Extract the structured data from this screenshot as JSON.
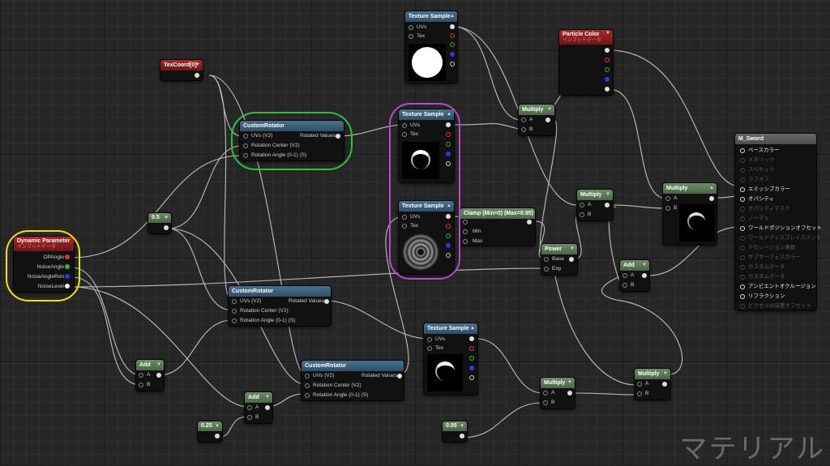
{
  "nodes": {
    "tex_sample_top": {
      "title": "Texture Sample",
      "pins": [
        "UVs",
        "Tex"
      ]
    },
    "particle_color": {
      "title": "Particle Color",
      "subtitle": "インプットデータ"
    },
    "texcoord": {
      "title": "TexCoord[0]"
    },
    "custom_rotator_1": {
      "title": "CustomRotator",
      "inputs": [
        "UVs (V2)",
        "Rotation Center (V2)",
        "Rotation Angle (0-1) (S)"
      ],
      "output": "Rotated Values"
    },
    "tex_sample_2": {
      "title": "Texture Sample",
      "pins": [
        "UVs",
        "Tex"
      ]
    },
    "multiply_1": {
      "title": "Multiply",
      "pins": [
        "A",
        "B"
      ]
    },
    "const_05": {
      "value": "0.5"
    },
    "dynamic_param": {
      "title": "Dynamic Parameter",
      "subtitle": "インプットデータ",
      "outputs": [
        "OPAngle",
        "NoiseAngle",
        "NoiseAngleRon",
        "NoiseLevel"
      ]
    },
    "tex_sample_3": {
      "title": "Texture Sample",
      "pins": [
        "UVs",
        "Tex"
      ]
    },
    "clamp": {
      "title": "Clamp (Min=0) (Max=0.95)",
      "pins": [
        "Min",
        "Max"
      ]
    },
    "multiply_2": {
      "title": "Multiply",
      "pins": [
        "A",
        "B"
      ]
    },
    "power": {
      "title": "Power",
      "pins": [
        "Base",
        "Exp"
      ]
    },
    "multiply_3": {
      "title": "Multiply",
      "pins": [
        "A",
        "B"
      ]
    },
    "add_1": {
      "title": "Add",
      "pins": [
        "A",
        "B"
      ]
    },
    "custom_rotator_2": {
      "title": "CustomRotator",
      "inputs": [
        "UVs (V2)",
        "Rotation Center (V2)",
        "Rotation Angle (0-1) (S)"
      ],
      "output": "Rotated Values"
    },
    "tex_sample_4": {
      "title": "Texture Sample",
      "pins": [
        "UVs",
        "Tex"
      ]
    },
    "add_2": {
      "title": "Add",
      "pins": [
        "A",
        "B"
      ]
    },
    "custom_rotator_3": {
      "title": "CustomRotator",
      "inputs": [
        "UVs (V2)",
        "Rotation Center (V2)",
        "Rotation Angle (0-1) (S)"
      ],
      "output": "Rotated Values"
    },
    "add_3": {
      "title": "Add",
      "pins": [
        "A",
        "B"
      ]
    },
    "const_025": {
      "value": "0.25"
    },
    "multiply_4": {
      "title": "Multiply",
      "pins": [
        "A",
        "B"
      ]
    },
    "multiply_5": {
      "title": "Multiply",
      "pins": [
        "A",
        "B"
      ]
    },
    "const_005": {
      "value": "0.05"
    }
  },
  "material": {
    "title": "M_Sword",
    "inputs": [
      {
        "label": "ベースカラー",
        "active": true
      },
      {
        "label": "メタリック",
        "active": false
      },
      {
        "label": "スペキュラ",
        "active": false
      },
      {
        "label": "ラフネス",
        "active": false
      },
      {
        "label": "エミッシブカラー",
        "active": true
      },
      {
        "label": "オパシティ",
        "active": true
      },
      {
        "label": "オパシティマスク",
        "active": false
      },
      {
        "label": "ノーマル",
        "active": false
      },
      {
        "label": "ワールドポジションオフセット",
        "active": true
      },
      {
        "label": "ワールドディスプレイスメント",
        "active": false
      },
      {
        "label": "テセレーション乗数",
        "active": false
      },
      {
        "label": "サブサーフェスカラー",
        "active": false
      },
      {
        "label": "カスタムデータ",
        "active": false
      },
      {
        "label": "カスタムデータ",
        "active": false
      },
      {
        "label": "アンビエントオクルージョン",
        "active": true
      },
      {
        "label": "リフラクション",
        "active": true
      },
      {
        "label": "ピクセルの深度オフセット",
        "active": false
      }
    ]
  },
  "colors": {
    "highlight_green": "#2fbf3c",
    "highlight_purple": "#b44bc8",
    "highlight_yellow": "#f2e200",
    "wire": "#d8d8d8"
  },
  "watermark": "マテリアル"
}
